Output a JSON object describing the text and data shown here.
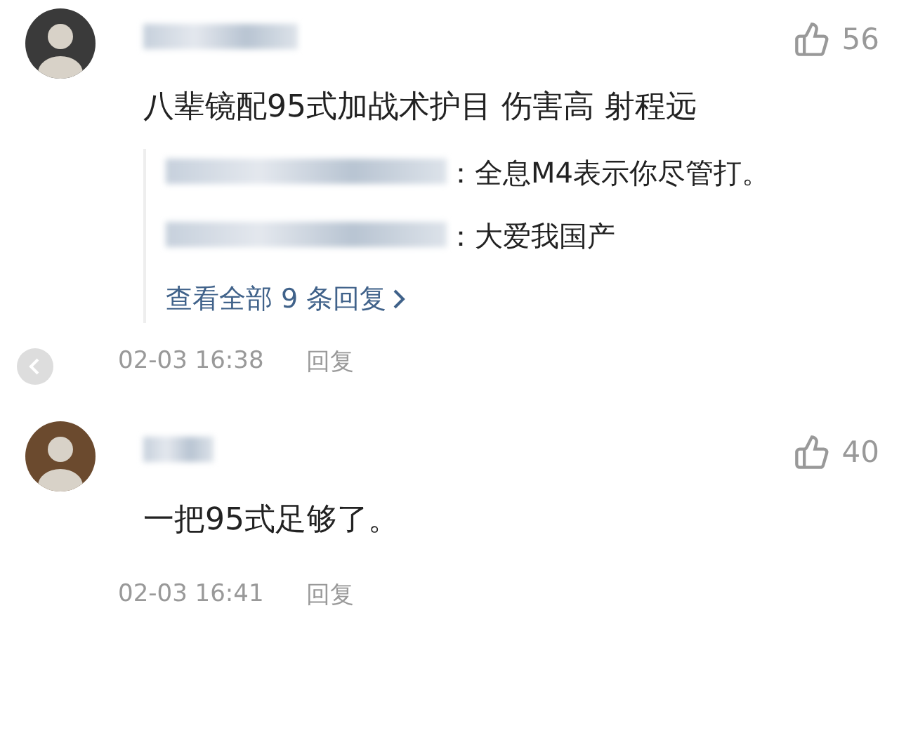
{
  "comments": [
    {
      "likes": "56",
      "text": "八辈镜配95式加战术护目 伤害高 射程远",
      "replies": [
        {
          "text": "：全息M4表示你尽管打。"
        },
        {
          "text": "：大爱我国产"
        }
      ],
      "view_all": "查看全部 9 条回复",
      "time": "02-03 16:38",
      "reply_action": "回复"
    },
    {
      "likes": "40",
      "text": "一把95式足够了。",
      "time": "02-03 16:41",
      "reply_action": "回复"
    }
  ]
}
